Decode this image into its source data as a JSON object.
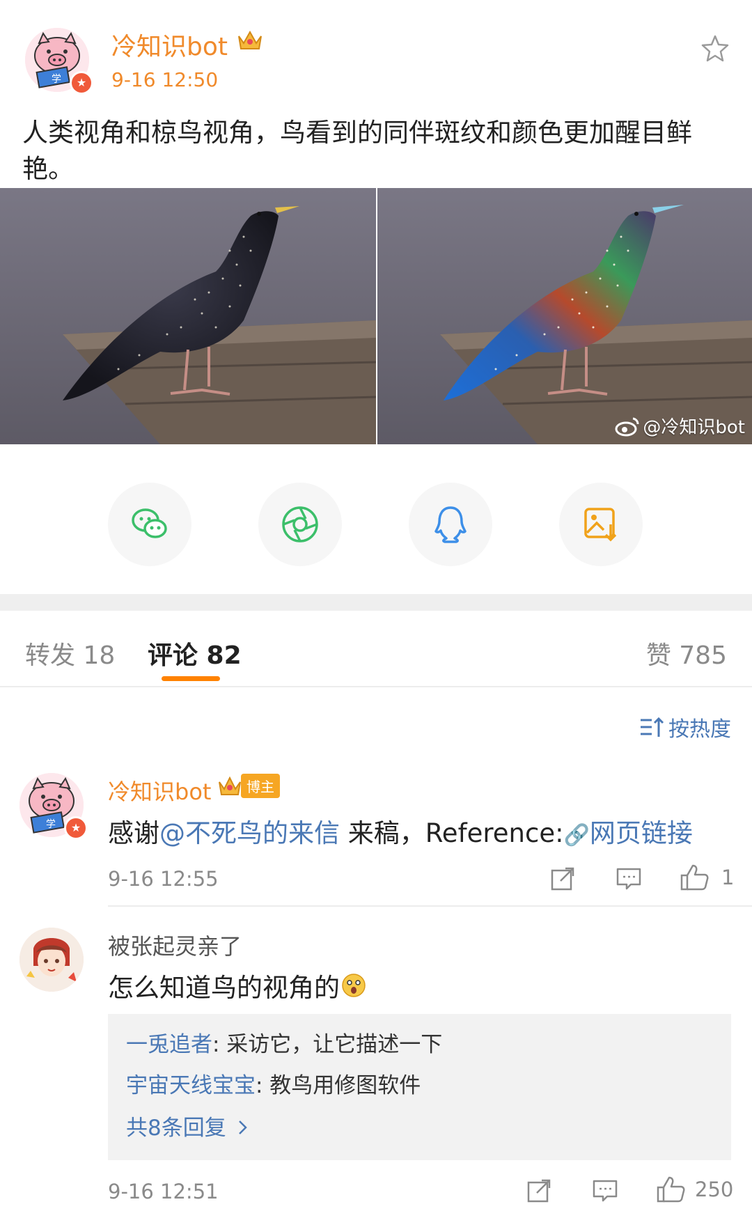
{
  "post": {
    "author": "冷知识bot",
    "time": "9-16 12:50",
    "text_line1": "人类视角和椋鸟视角，鸟看到的同伴斑纹和颜色更加醒目鲜",
    "text_line2": "艳。",
    "watermark": "@冷知识bot"
  },
  "share": {
    "icons": [
      "wechat-icon",
      "moments-icon",
      "qq-icon",
      "save-image-icon"
    ]
  },
  "tabs": {
    "repost_label": "转发 18",
    "comment_label": "评论 82",
    "like_label": "赞 785",
    "active": "comment"
  },
  "sort": {
    "label": "按热度"
  },
  "comments": [
    {
      "author": "冷知识bot",
      "badge": "博主",
      "text_prefix": "感谢",
      "mention": "@不死鸟的来信",
      "text_middle": " 来稿，Reference:",
      "link_label": "网页链接",
      "time": "9-16 12:55",
      "like_count": "1"
    },
    {
      "author": "被张起灵亲了",
      "text": "怎么知道鸟的视角的",
      "replies": [
        {
          "user": "一兎追者",
          "text": ": 采访它，让它描述一下"
        },
        {
          "user": "宇宙天线宝宝",
          "text": ": 教鸟用修图软件"
        }
      ],
      "more_replies": "共8条回复",
      "time": "9-16 12:51",
      "like_count": "250"
    }
  ],
  "colors": {
    "accent_orange": "#f08a2b",
    "link_blue": "#4a78b5",
    "tab_indicator": "#ff8200"
  }
}
